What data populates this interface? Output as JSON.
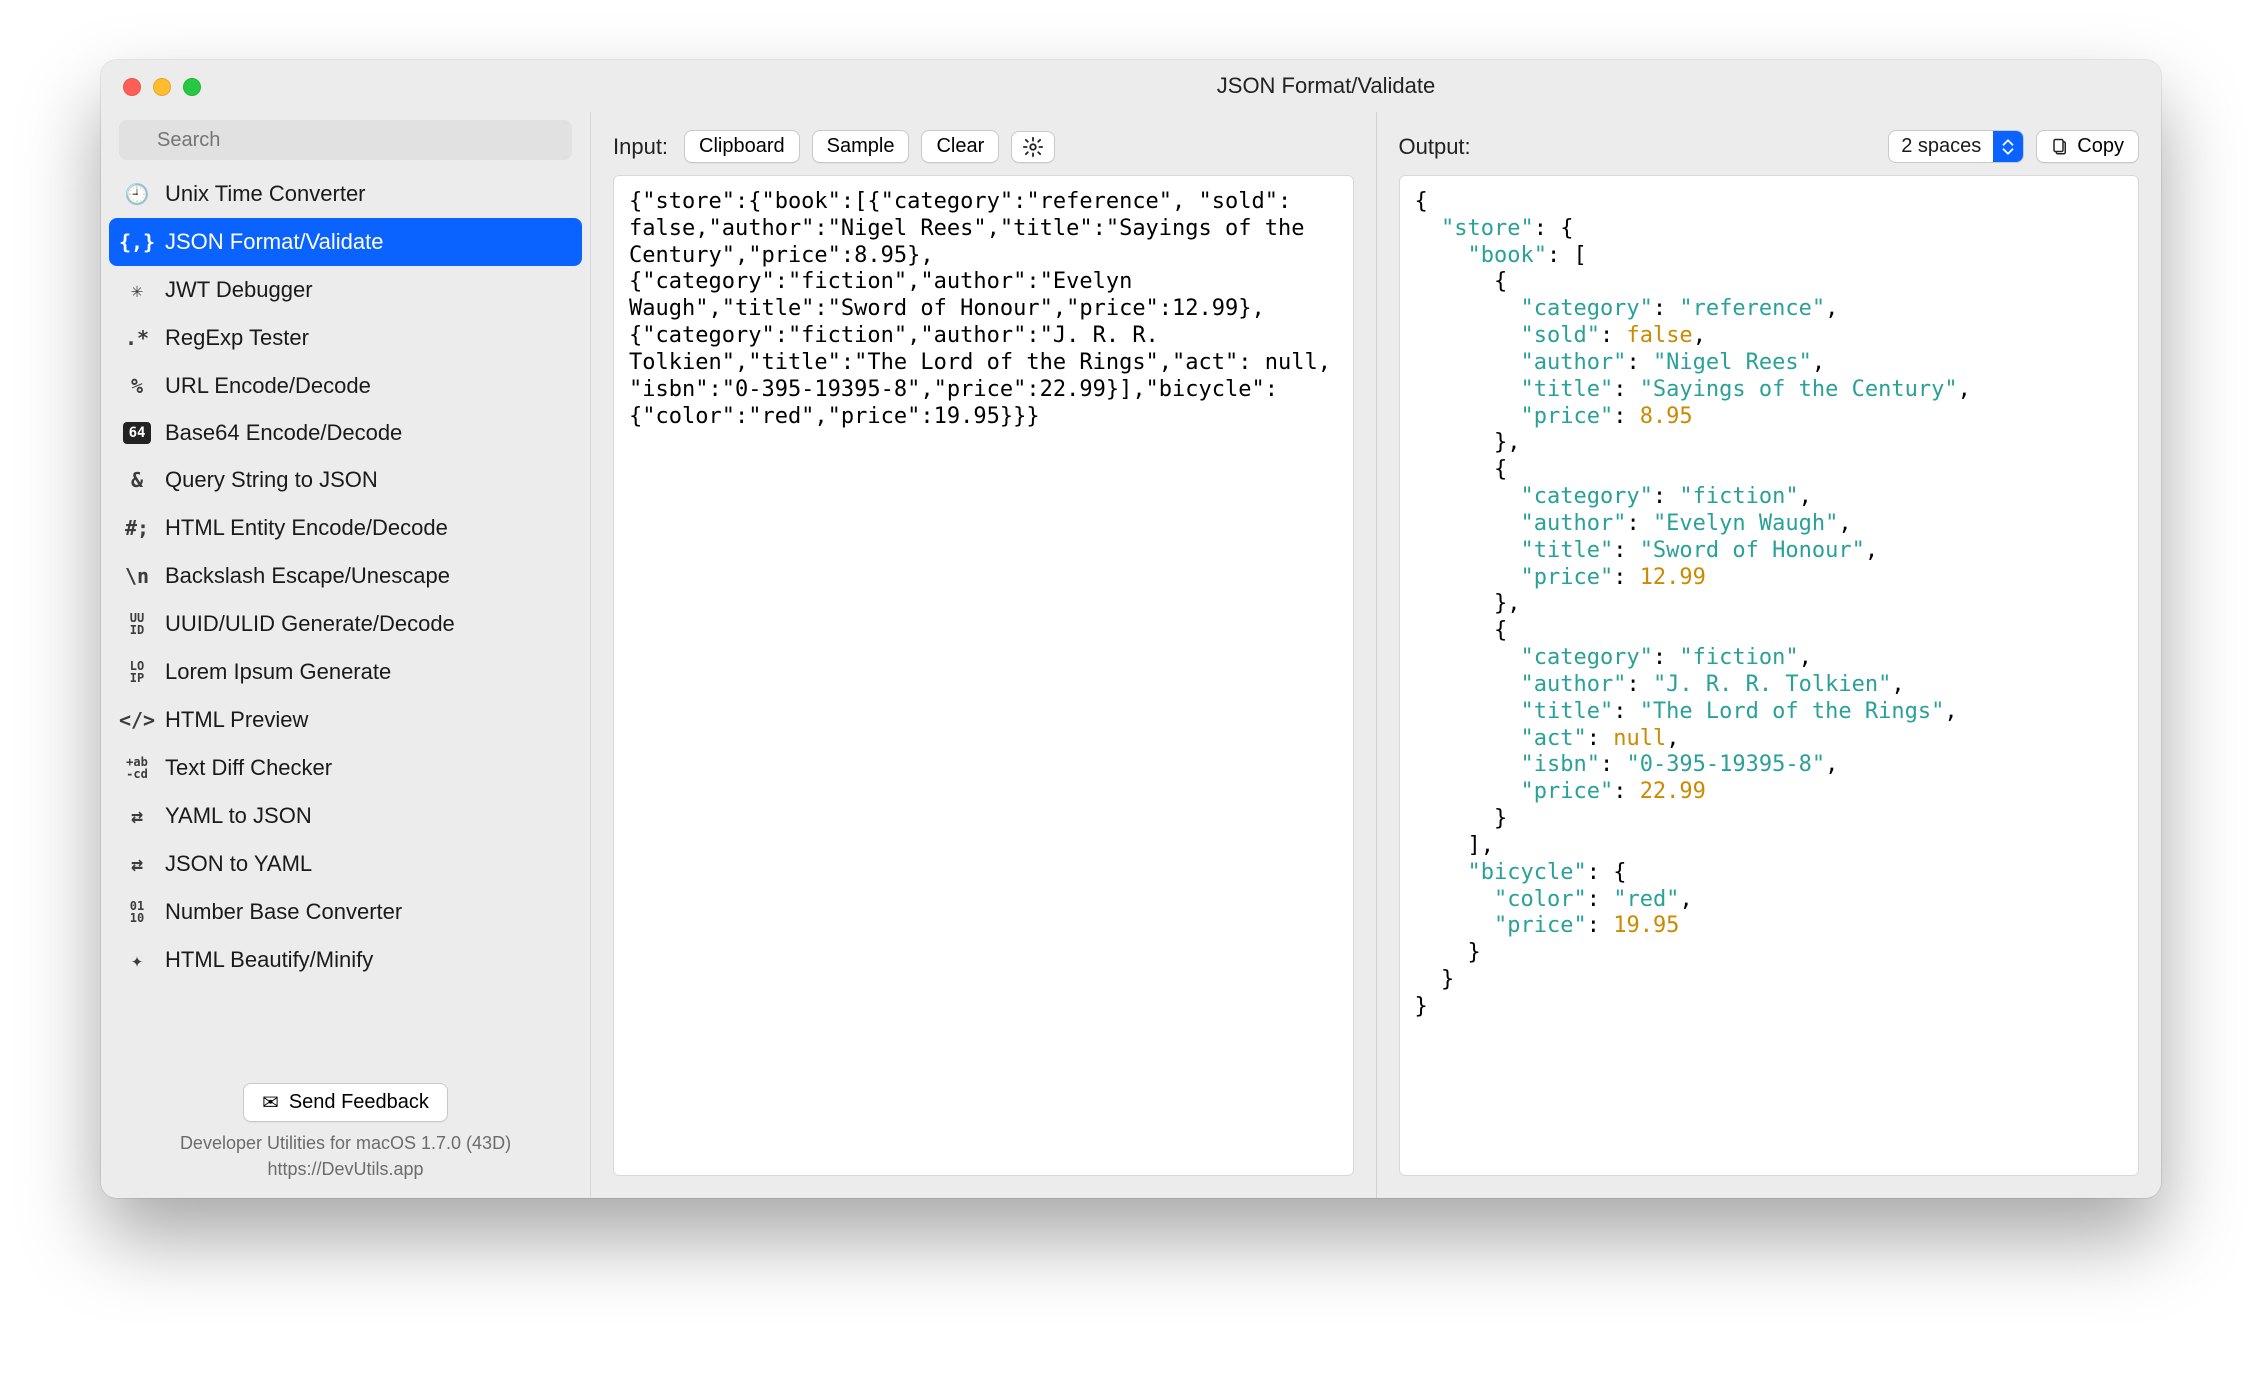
{
  "window": {
    "title": "JSON Format/Validate"
  },
  "sidebar": {
    "search_placeholder": "Search",
    "items": [
      {
        "icon": "clock-icon",
        "label": "Unix Time Converter",
        "selected": false
      },
      {
        "icon": "json-icon",
        "label": "JSON Format/Validate",
        "selected": true
      },
      {
        "icon": "jwt-icon",
        "label": "JWT Debugger",
        "selected": false
      },
      {
        "icon": "regex-icon",
        "label": "RegExp Tester",
        "selected": false
      },
      {
        "icon": "percent-icon",
        "label": "URL Encode/Decode",
        "selected": false
      },
      {
        "icon": "base64-icon",
        "label": "Base64 Encode/Decode",
        "selected": false
      },
      {
        "icon": "ampersand-icon",
        "label": "Query String to JSON",
        "selected": false
      },
      {
        "icon": "hash-icon",
        "label": "HTML Entity Encode/Decode",
        "selected": false
      },
      {
        "icon": "backslash-icon",
        "label": "Backslash Escape/Unescape",
        "selected": false
      },
      {
        "icon": "uuid-icon",
        "label": "UUID/ULID Generate/Decode",
        "selected": false
      },
      {
        "icon": "lorem-icon",
        "label": "Lorem Ipsum Generate",
        "selected": false
      },
      {
        "icon": "html-icon",
        "label": "HTML Preview",
        "selected": false
      },
      {
        "icon": "diff-icon",
        "label": "Text Diff Checker",
        "selected": false
      },
      {
        "icon": "swap-icon",
        "label": "YAML to JSON",
        "selected": false
      },
      {
        "icon": "swap-icon",
        "label": "JSON to YAML",
        "selected": false
      },
      {
        "icon": "binary-icon",
        "label": "Number Base Converter",
        "selected": false
      },
      {
        "icon": "wand-icon",
        "label": "HTML Beautify/Minify",
        "selected": false
      }
    ],
    "feedback_label": "Send Feedback",
    "meta_line1": "Developer Utilities for macOS 1.7.0 (43D)",
    "meta_line2": "https://DevUtils.app"
  },
  "input_pane": {
    "label": "Input:",
    "clipboard_label": "Clipboard",
    "sample_label": "Sample",
    "clear_label": "Clear",
    "code": "{\"store\":{\"book\":[{\"category\":\"reference\", \"sold\": false,\"author\":\"Nigel Rees\",\"title\":\"Sayings of the Century\",\"price\":8.95},{\"category\":\"fiction\",\"author\":\"Evelyn Waugh\",\"title\":\"Sword of Honour\",\"price\":12.99},{\"category\":\"fiction\",\"author\":\"J. R. R. Tolkien\",\"title\":\"The Lord of the Rings\",\"act\": null, \"isbn\":\"0-395-19395-8\",\"price\":22.99}],\"bicycle\":{\"color\":\"red\",\"price\":19.95}}}"
  },
  "output_pane": {
    "label": "Output:",
    "indent_selected": "2 spaces",
    "copy_label": "Copy",
    "json": {
      "store": {
        "book": [
          {
            "category": "reference",
            "sold": false,
            "author": "Nigel Rees",
            "title": "Sayings of the Century",
            "price": 8.95
          },
          {
            "category": "fiction",
            "author": "Evelyn Waugh",
            "title": "Sword of Honour",
            "price": 12.99
          },
          {
            "category": "fiction",
            "author": "J. R. R. Tolkien",
            "title": "The Lord of the Rings",
            "act": null,
            "isbn": "0-395-19395-8",
            "price": 22.99
          }
        ],
        "bicycle": {
          "color": "red",
          "price": 19.95
        }
      }
    }
  }
}
